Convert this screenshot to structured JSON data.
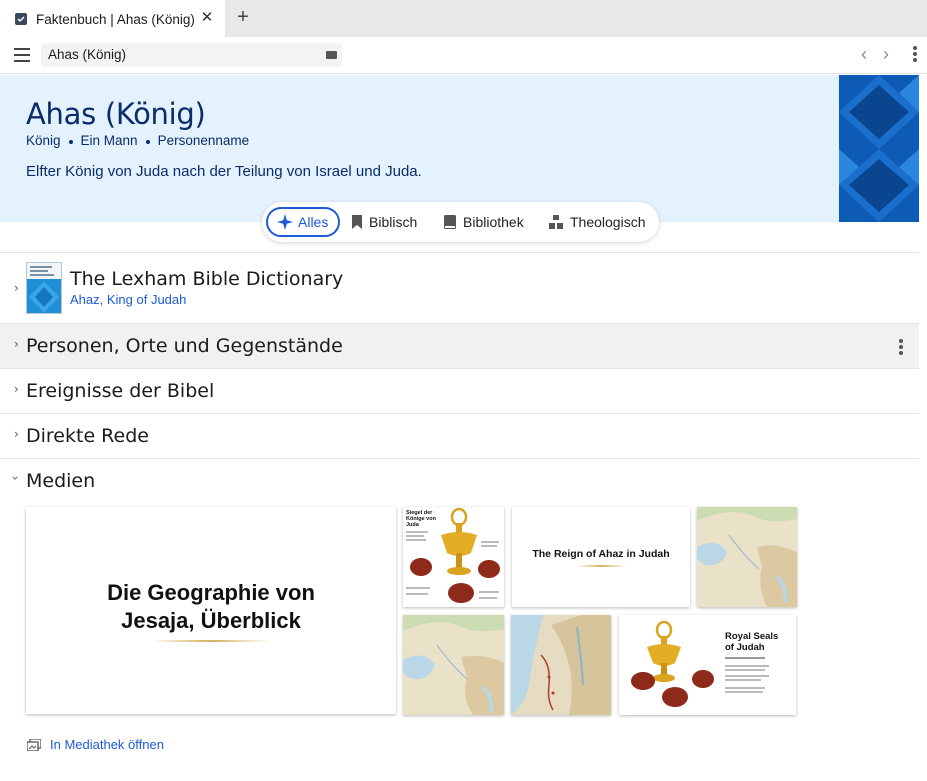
{
  "tab": {
    "title": "Faktenbuch | Ahas (König)",
    "close": "✕",
    "new": "+"
  },
  "toolbar": {
    "address": "Ahas (König)",
    "back": "‹",
    "forward": "›"
  },
  "hero": {
    "title": "Ahas (König)",
    "tags": [
      "König",
      "Ein Mann",
      "Personenname"
    ],
    "description": "Elfter König von Juda nach der Teilung von Israel und Juda."
  },
  "filters": [
    {
      "label": "Alles",
      "icon": "sparkle-icon",
      "active": true
    },
    {
      "label": "Biblisch",
      "icon": "bookmark-icon"
    },
    {
      "label": "Bibliothek",
      "icon": "book-icon"
    },
    {
      "label": "Theologisch",
      "icon": "hierarchy-icon"
    }
  ],
  "dictionary": {
    "title": "The Lexham Bible Dictionary",
    "link": "Ahaz, King of Judah"
  },
  "sections": [
    {
      "title": "Personen, Orte und Gegenstände"
    },
    {
      "title": "Ereignisse der Bibel"
    },
    {
      "title": "Direkte Rede"
    },
    {
      "title": "Medien"
    }
  ],
  "media": {
    "big_slide_line1": "Die Geographie von",
    "big_slide_line2": "Jesaja, Überblick",
    "seals_title_de_1": "Siegel der",
    "seals_title_de_2": "Könige von",
    "seals_title_de_3": "Juda",
    "reign_title": "The Reign of Ahaz in Judah",
    "royal_title_1": "Royal Seals",
    "royal_title_2": "of Judah",
    "open_library": "In Mediathek öffnen"
  },
  "colors": {
    "accent": "#1c5bd6",
    "hero_bg": "#e4f2fd",
    "title": "#0a2c6b"
  }
}
